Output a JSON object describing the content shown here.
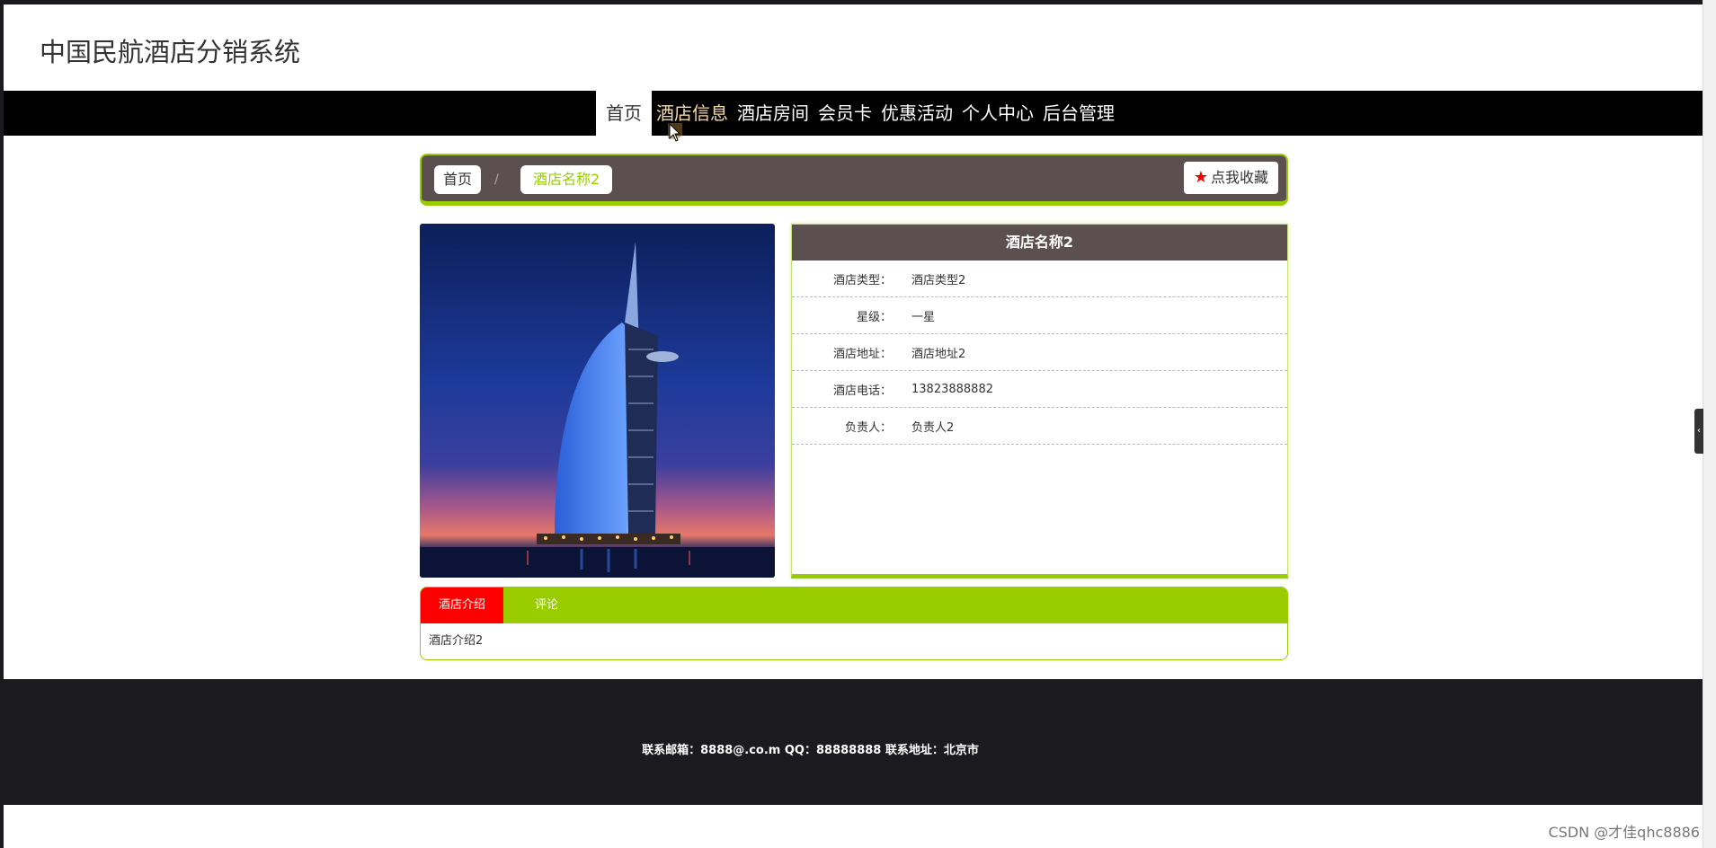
{
  "site": {
    "title": "中国民航酒店分销系统"
  },
  "nav": {
    "items": [
      {
        "label": "首页"
      },
      {
        "label": "酒店信息"
      },
      {
        "label": "酒店房间"
      },
      {
        "label": "会员卡"
      },
      {
        "label": "优惠活动"
      },
      {
        "label": "个人中心"
      },
      {
        "label": "后台管理"
      }
    ]
  },
  "breadcrumb": {
    "home": "首页",
    "separator": "/",
    "current": "酒店名称2",
    "favorite_label": "点我收藏"
  },
  "hotel": {
    "name": "酒店名称2",
    "fields": [
      {
        "label": "酒店类型：",
        "value": "酒店类型2"
      },
      {
        "label": "星级：",
        "value": "一星"
      },
      {
        "label": "酒店地址：",
        "value": "酒店地址2"
      },
      {
        "label": "酒店电话：",
        "value": "13823888882"
      },
      {
        "label": "负责人：",
        "value": "负责人2"
      }
    ]
  },
  "tabs": {
    "items": [
      {
        "label": "酒店介绍"
      },
      {
        "label": "评论"
      }
    ],
    "content": "酒店介绍2"
  },
  "footer": {
    "text": "联系邮箱：8888@.co.m QQ：88888888 联系地址：北京市"
  },
  "watermark": "CSDN @才佳qhc8886",
  "colors": {
    "accent": "#9acd00",
    "header_bg": "#5b4f50",
    "tab_active": "#ff0000",
    "nav_bg": "#000000",
    "footer_bg": "#1b1a1f"
  }
}
